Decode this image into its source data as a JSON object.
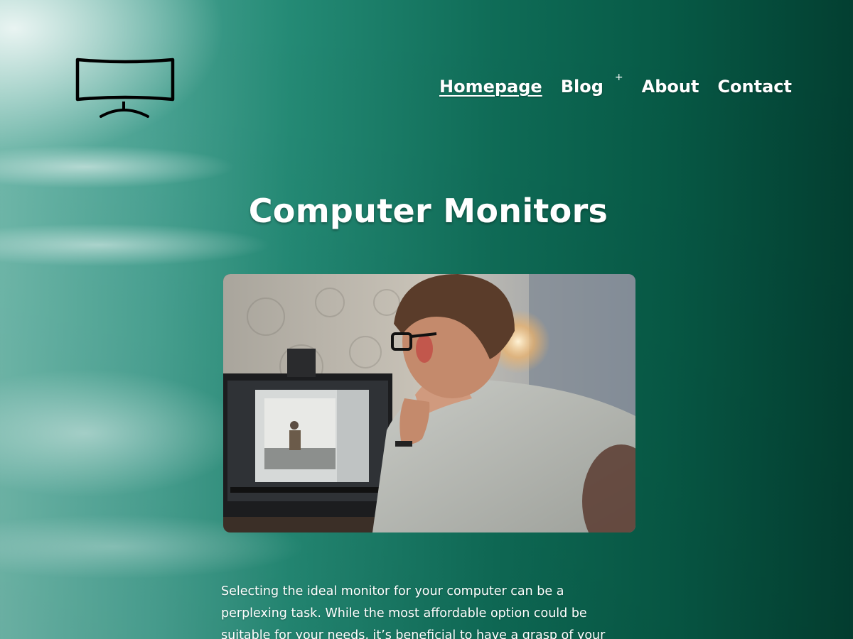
{
  "site": {
    "logo_icon": "curved-monitor-icon"
  },
  "nav": {
    "items": [
      {
        "label": "Homepage",
        "active": true
      },
      {
        "label": "Blog",
        "has_submenu": true
      },
      {
        "label": "About"
      },
      {
        "label": "Contact"
      }
    ],
    "submenu_toggle": "+"
  },
  "page": {
    "title": "Computer Monitors",
    "hero_image": "photo-man-with-glasses-at-monitor",
    "intro": "Selecting the ideal monitor for your computer can be a perplexing task. While the most affordable option could be suitable for your needs, it’s beneficial to have a grasp of your choices and the"
  },
  "colors": {
    "background_dark": "#033f31",
    "background_mid": "#0f6c57",
    "background_light": "#6fb8aa",
    "text": "#ffffff"
  }
}
